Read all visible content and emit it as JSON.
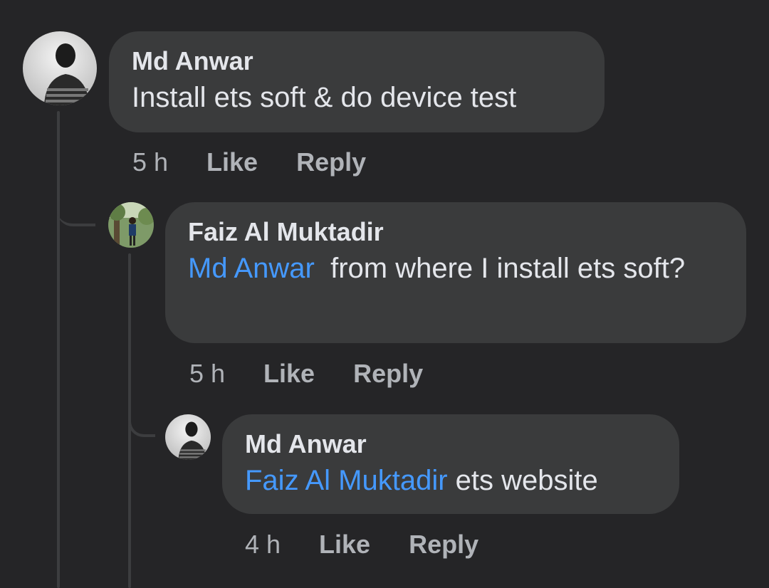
{
  "comments": [
    {
      "author": "Md Anwar",
      "mention": "",
      "text": "Install ets soft & do device test",
      "time": "5 h",
      "like": "Like",
      "reply": "Reply"
    },
    {
      "author": "Faiz Al Muktadir",
      "mention": "Md Anwar",
      "text": "from where I install ets soft?",
      "time": "5 h",
      "like": "Like",
      "reply": "Reply"
    },
    {
      "author": "Md Anwar",
      "mention": "Faiz Al Muktadir",
      "text": "ets website",
      "time": "4 h",
      "like": "Like",
      "reply": "Reply"
    }
  ],
  "colors": {
    "background": "#252527",
    "bubble": "#3a3b3c",
    "mention": "#4599ff",
    "meta": "#b0b3b8"
  }
}
